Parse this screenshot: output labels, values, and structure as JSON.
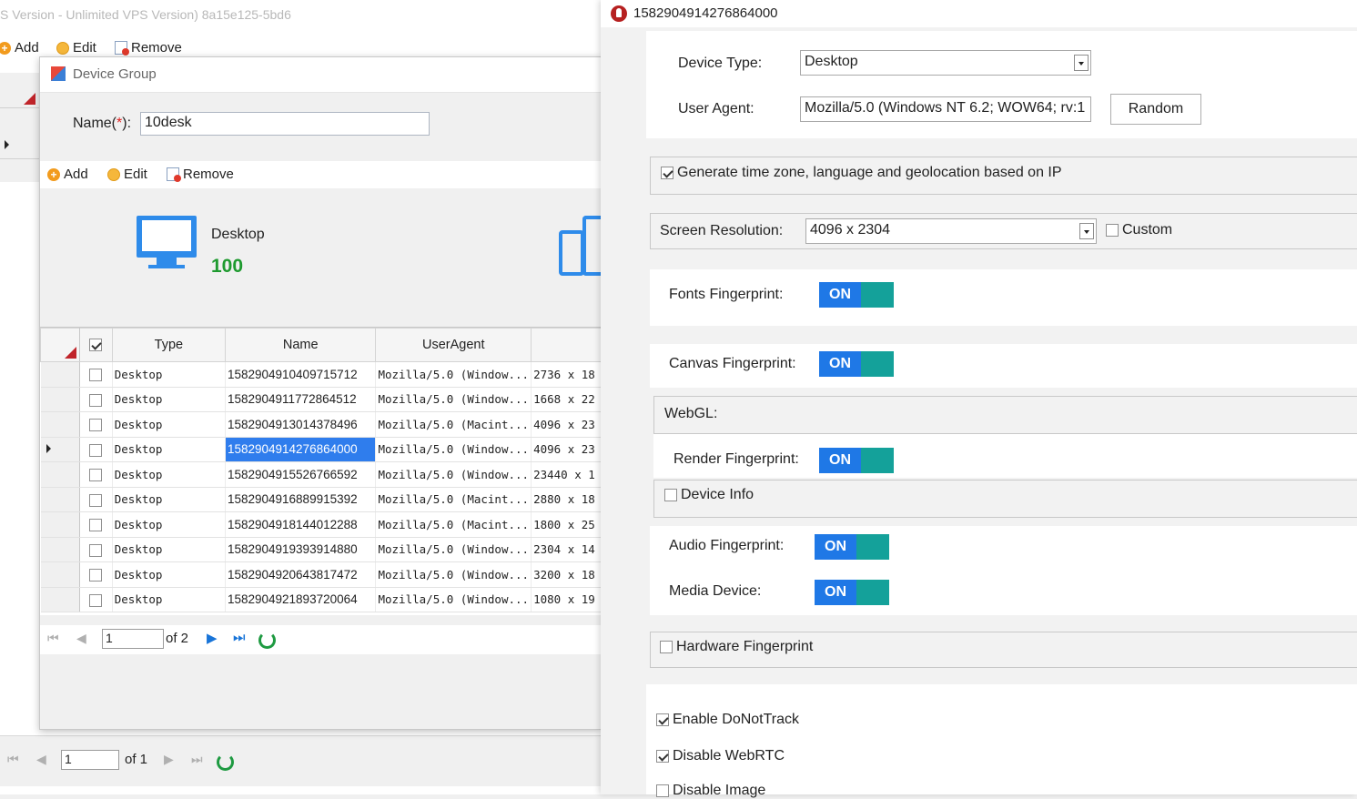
{
  "back_window": {
    "title": "S Version - Unlimited VPS Version) 8a15e125-5bd6",
    "toolbar": {
      "add": "Add",
      "edit": "Edit",
      "remove": "Remove"
    },
    "pager": {
      "page": "1",
      "of": "of 1"
    }
  },
  "dialog": {
    "title": "Device Group",
    "name_label": "Name(",
    "name_required": "*",
    "name_label_end": "):",
    "name_value": "10desk",
    "toolbar": {
      "add": "Add",
      "edit": "Edit",
      "remove": "Remove"
    },
    "summary": {
      "label": "Desktop",
      "count": "100"
    },
    "grid": {
      "columns": [
        "Type",
        "Name",
        "UserAgent"
      ],
      "rows": [
        {
          "type": "Desktop",
          "name": "1582904910409715712",
          "ua": "Mozilla/5.0 (Window...",
          "res": "2736 x 18"
        },
        {
          "type": "Desktop",
          "name": "1582904911772864512",
          "ua": "Mozilla/5.0 (Window...",
          "res": "1668 x 22"
        },
        {
          "type": "Desktop",
          "name": "1582904913014378496",
          "ua": "Mozilla/5.0 (Macint...",
          "res": "4096 x 23"
        },
        {
          "type": "Desktop",
          "name": "1582904914276864000",
          "ua": "Mozilla/5.0 (Window...",
          "res": "4096 x 23"
        },
        {
          "type": "Desktop",
          "name": "1582904915526766592",
          "ua": "Mozilla/5.0 (Window...",
          "res": "23440 x 1"
        },
        {
          "type": "Desktop",
          "name": "1582904916889915392",
          "ua": "Mozilla/5.0 (Macint...",
          "res": "2880 x 18"
        },
        {
          "type": "Desktop",
          "name": "1582904918144012288",
          "ua": "Mozilla/5.0 (Macint...",
          "res": "1800 x 25"
        },
        {
          "type": "Desktop",
          "name": "1582904919393914880",
          "ua": "Mozilla/5.0 (Window...",
          "res": "2304 x 14"
        },
        {
          "type": "Desktop",
          "name": "1582904920643817472",
          "ua": "Mozilla/5.0 (Window...",
          "res": "3200 x 18"
        },
        {
          "type": "Desktop",
          "name": "1582904921893720064",
          "ua": "Mozilla/5.0 (Window...",
          "res": "1080 x 19"
        }
      ]
    },
    "pager": {
      "page": "1",
      "of": "of 2"
    }
  },
  "profile": {
    "title": "1582904914276864000",
    "device_type_label": "Device Type:",
    "device_type_value": "Desktop",
    "user_agent_label": "User Agent:",
    "user_agent_value": "Mozilla/5.0 (Windows NT 6.2; WOW64; rv:1",
    "random_button": "Random",
    "geo_checkbox": "Generate time zone, language and geolocation based on IP",
    "screen_res_label": "Screen Resolution:",
    "screen_res_value": "4096 x 2304",
    "custom_label": "Custom",
    "fonts_label": "Fonts Fingerprint:",
    "canvas_label": "Canvas Fingerprint:",
    "webgl_label": "WebGL:",
    "render_label": "Render Fingerprint:",
    "device_info_label": "Device Info",
    "audio_label": "Audio Fingerprint:",
    "media_label": "Media Device:",
    "hardware_label": "Hardware Fingerprint",
    "dnt_label": "Enable DoNotTrack",
    "webrtc_label": "Disable WebRTC",
    "image_label": "Disable Image",
    "toggle_on": "ON"
  },
  "colors": {
    "accent_blue": "#1f78e6",
    "toggle_teal": "#14a19a",
    "selection": "#2f7ded",
    "count_green": "#1e9a2f"
  }
}
